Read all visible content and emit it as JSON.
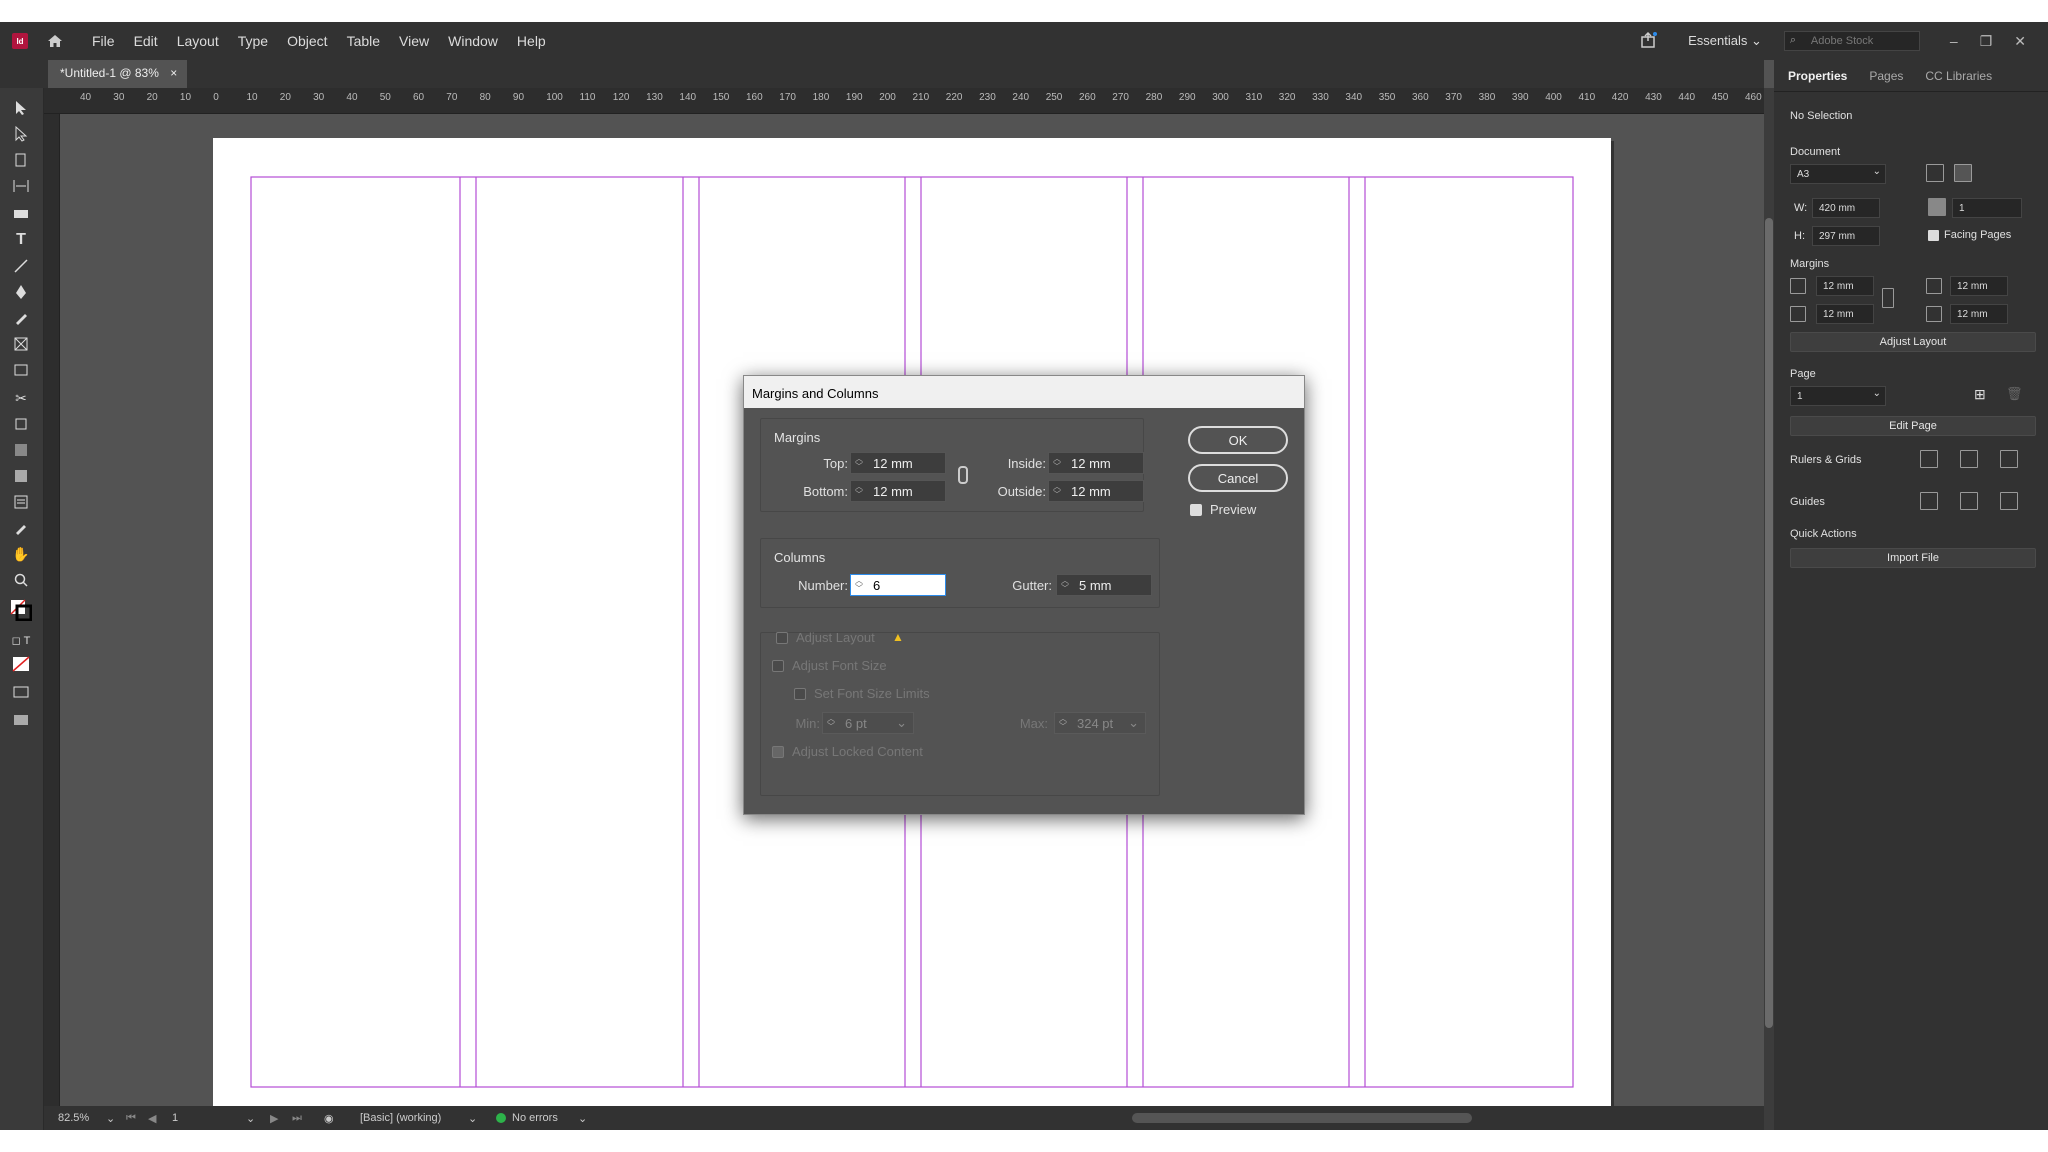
{
  "app": {
    "logo": "Id"
  },
  "menu": [
    "File",
    "Edit",
    "Layout",
    "Type",
    "Object",
    "Table",
    "View",
    "Window",
    "Help"
  ],
  "workspace": "Essentials",
  "search_placeholder": "Adobe Stock",
  "document_tab": {
    "title": "*Untitled-1 @ 83%",
    "close": "×"
  },
  "ruler_h": [
    "40",
    "30",
    "20",
    "10",
    "0",
    "10",
    "20",
    "30",
    "40",
    "50",
    "60",
    "70",
    "80",
    "90",
    "100",
    "110",
    "120",
    "130",
    "140",
    "150",
    "160",
    "170",
    "180",
    "190",
    "200",
    "210",
    "220",
    "230",
    "240",
    "250",
    "260",
    "270",
    "280",
    "290",
    "300",
    "310",
    "320",
    "330",
    "340",
    "350",
    "360",
    "370",
    "380",
    "390",
    "400",
    "410",
    "420",
    "430",
    "440",
    "450",
    "460"
  ],
  "panel": {
    "tabs": [
      "Properties",
      "Pages",
      "CC Libraries"
    ],
    "selection": "No Selection",
    "document_label": "Document",
    "page_size": "A3",
    "w_label": "W:",
    "w_value": "420 mm",
    "h_label": "H:",
    "h_value": "297 mm",
    "pages_count": "1",
    "facing_pages": "Facing Pages",
    "margins_label": "Margins",
    "margin_top": "12 mm",
    "margin_bottom": "12 mm",
    "margin_inside": "12 mm",
    "margin_outside": "12 mm",
    "adjust_layout": "Adjust Layout",
    "page_label": "Page",
    "page_value": "1",
    "edit_page": "Edit Page",
    "rulers_grids": "Rulers & Grids",
    "guides": "Guides",
    "quick_actions": "Quick Actions",
    "import_file": "Import File"
  },
  "dialog": {
    "title": "Margins and Columns",
    "margins_label": "Margins",
    "top_label": "Top:",
    "top_value": "12 mm",
    "bottom_label": "Bottom:",
    "bottom_value": "12 mm",
    "inside_label": "Inside:",
    "inside_value": "12 mm",
    "outside_label": "Outside:",
    "outside_value": "12 mm",
    "columns_label": "Columns",
    "number_label": "Number:",
    "number_value": "6",
    "gutter_label": "Gutter:",
    "gutter_value": "5 mm",
    "ok": "OK",
    "cancel": "Cancel",
    "preview": "Preview",
    "adjust_layout": "Adjust Layout",
    "adjust_font_size": "Adjust Font Size",
    "set_font_size_limits": "Set Font Size Limits",
    "min_label": "Min:",
    "min_value": "6 pt",
    "max_label": "Max:",
    "max_value": "324 pt",
    "adjust_locked": "Adjust Locked Content"
  },
  "status": {
    "zoom": "82.5%",
    "page": "1",
    "style": "[Basic] (working)",
    "errors": "No errors"
  },
  "colors": {
    "guide": "#b44dd6",
    "accent": "#b0153e",
    "ok_green": "#2db34a"
  }
}
